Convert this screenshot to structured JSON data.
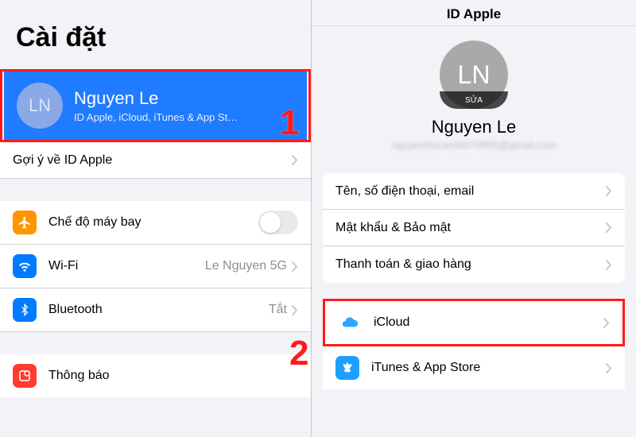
{
  "left": {
    "title": "Cài đặt",
    "profile": {
      "initials": "LN",
      "name": "Nguyen Le",
      "subtitle": "ID Apple, iCloud, iTunes & App St…"
    },
    "suggestion": "Gợi ý về ID Apple",
    "airplane": "Chế độ máy bay",
    "wifi": {
      "label": "Wi-Fi",
      "value": "Le Nguyen 5G"
    },
    "bluetooth": {
      "label": "Bluetooth",
      "value": "Tắt"
    },
    "notify": "Thông báo"
  },
  "right": {
    "navtitle": "ID Apple",
    "initials": "LN",
    "edit": "SỬA",
    "name": "Nguyen Le",
    "email": "nguyenthicamle070895@gmail.com",
    "items": {
      "name_phone": "Tên, số điện thoại, email",
      "password": "Mật khẩu & Bảo mật",
      "payment": "Thanh toán & giao hàng",
      "icloud": "iCloud",
      "itunes": "iTunes & App Store"
    }
  },
  "steps": {
    "one": "1",
    "two": "2"
  }
}
